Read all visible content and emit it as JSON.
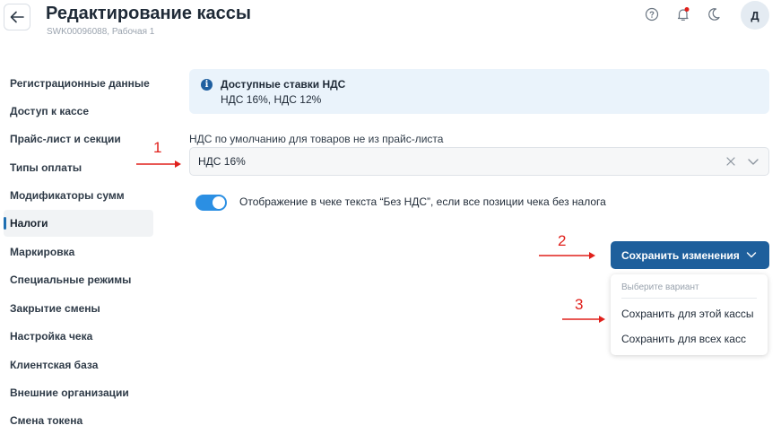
{
  "header": {
    "title": "Редактирование кассы",
    "subtitle": "SWK00096088, Рабочая 1",
    "avatar_letter": "Д"
  },
  "header_icons": [
    "back-arrow-icon",
    "help-icon",
    "bell-icon",
    "moon-icon"
  ],
  "sidebar": {
    "items": [
      {
        "label": "Регистрационные данные"
      },
      {
        "label": "Доступ к кассе"
      },
      {
        "label": "Прайс-лист и секции"
      },
      {
        "label": "Типы оплаты"
      },
      {
        "label": "Модификаторы сумм"
      },
      {
        "label": "Налоги"
      },
      {
        "label": "Маркировка"
      },
      {
        "label": "Специальные режимы"
      },
      {
        "label": "Закрытие смены"
      },
      {
        "label": "Настройка чека"
      },
      {
        "label": "Клиентская база"
      },
      {
        "label": "Внешние организации"
      },
      {
        "label": "Смена токена"
      }
    ],
    "active_index": 5
  },
  "info": {
    "title": "Доступные ставки НДС",
    "text": "НДС 16%, НДС 12%"
  },
  "vat_field": {
    "label": "НДС по умолчанию для товаров не из прайс-листа",
    "value": "НДС 16%"
  },
  "toggle": {
    "label": "Отображение в чеке текста “Без НДС”, если все позиции чека без налога",
    "on": true
  },
  "save_button": {
    "label": "Сохранить изменения"
  },
  "save_menu": {
    "header": "Выберите вариант",
    "items": [
      "Сохранить для этой кассы",
      "Сохранить для всех касс"
    ]
  },
  "annotations": [
    "1",
    "2",
    "3"
  ],
  "colors": {
    "primary": "#1e5f9c",
    "toggle": "#2b8fe3",
    "info_bg": "#eaf3fb",
    "annotation": "#e0201b"
  }
}
